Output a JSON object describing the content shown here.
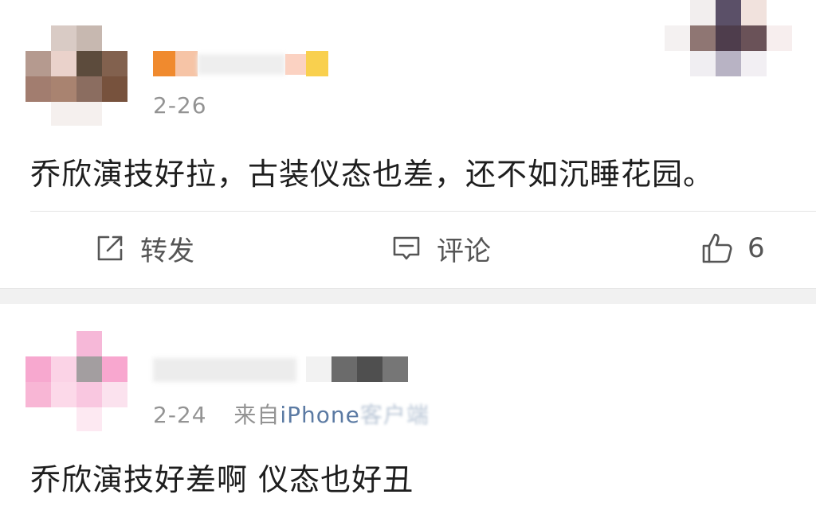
{
  "posts": [
    {
      "date": "2-26",
      "content": "乔欣演技好拉，古装仪态也差，还不如沉睡花园。",
      "actions": {
        "repost_label": "转发",
        "comment_label": "评论",
        "like_count": "6"
      },
      "icons": [
        "repost-icon",
        "comment-icon",
        "thumbs-up-icon"
      ]
    },
    {
      "date": "2-24",
      "source_prefix": "来自",
      "source_device": "iPhone",
      "source_client": "客户端",
      "content": "乔欣演技好差啊 仪态也好丑"
    }
  ],
  "colors": {
    "text": "#1e1e1e",
    "meta": "#939393",
    "link": "#5b7aa3",
    "separator": "#f1f1f1",
    "action": "#555555"
  }
}
